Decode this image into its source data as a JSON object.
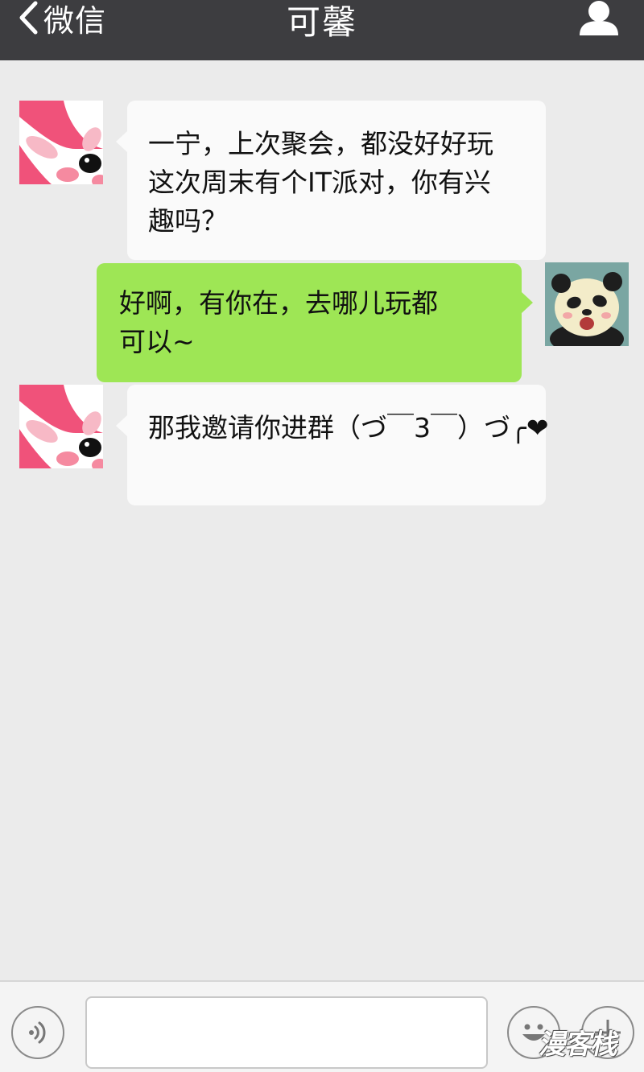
{
  "header": {
    "back_label": "微信",
    "title": "可馨"
  },
  "messages": [
    {
      "side": "incoming",
      "text": "一宁，上次聚会，都没好好玩这次周末有个IT派对，你有兴趣吗？",
      "lines": [
        "一宁，上次聚会，都没好好玩",
        "这次周末有个IT派对，你有兴",
        "趣吗？"
      ],
      "avatar": "bunny-avatar"
    },
    {
      "side": "outgoing",
      "text": "好啊，有你在，去哪儿玩都可以~",
      "lines": [
        "好啊，有你在，去哪儿玩都",
        "可以~"
      ],
      "avatar": "panda-avatar"
    },
    {
      "side": "incoming",
      "text": "那我邀请你进群（づ￣3￣）づ╭❤",
      "lines": [
        "那我邀请你进群（づ￣3￣）づ╭❤"
      ],
      "avatar": "bunny-avatar"
    }
  ],
  "input": {
    "value": "",
    "placeholder": ""
  },
  "icons": {
    "back": "chevron-left-icon",
    "profile": "person-icon",
    "voice": "voice-icon",
    "emoji": "smiley-icon",
    "more": "plus-icon"
  },
  "watermark": "漫客栈",
  "colors": {
    "topbar": "#3d3d40",
    "background": "#ebebeb",
    "incoming_bubble": "#fafafa",
    "outgoing_bubble": "#9ee655",
    "bunny_pink": "#f0527a"
  }
}
